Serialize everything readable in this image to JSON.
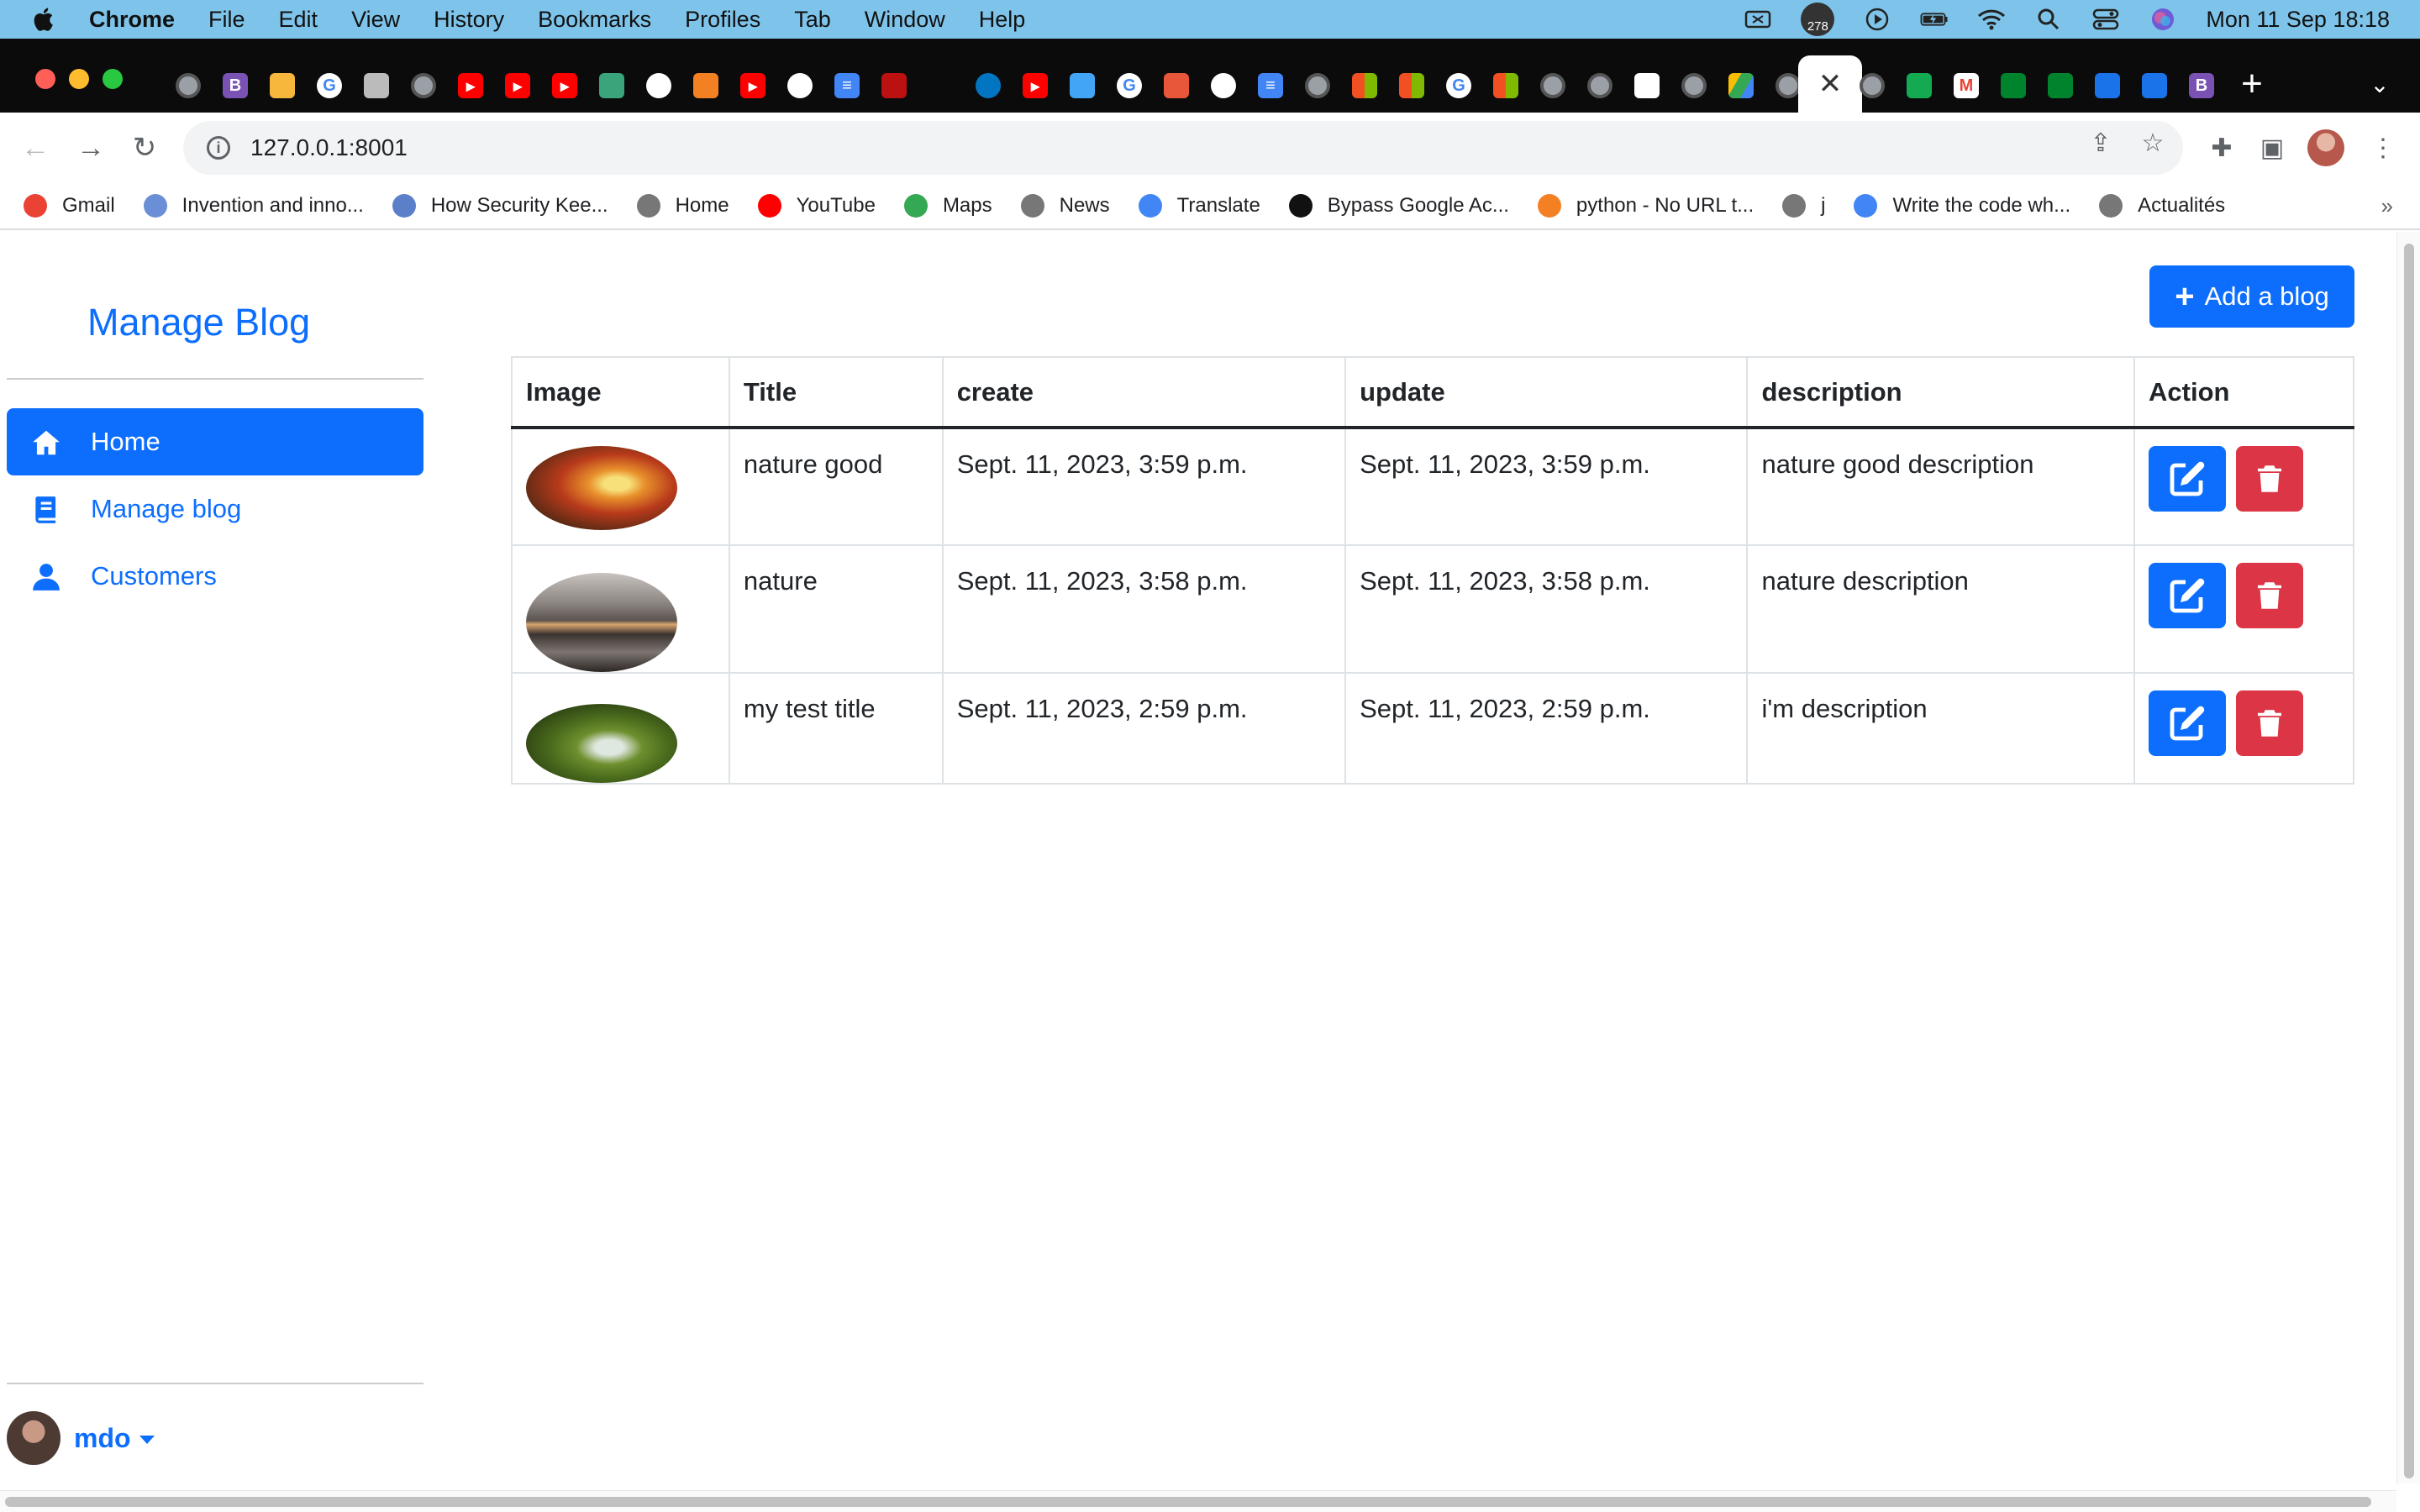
{
  "menubar": {
    "app": "Chrome",
    "items": [
      "File",
      "Edit",
      "View",
      "History",
      "Bookmarks",
      "Profiles",
      "Tab",
      "Window",
      "Help"
    ],
    "badge_count": "278",
    "datetime": "Mon 11 Sep  18:18"
  },
  "browser": {
    "url": "127.0.0.1:8001",
    "bookmarks": [
      {
        "label": "Gmail",
        "icon": "gmail-icon",
        "color": "#ea4335"
      },
      {
        "label": "Invention and inno...",
        "icon": "shield-icon",
        "color": "#6b8fd6"
      },
      {
        "label": "How Security Kee...",
        "icon": "cube-icon",
        "color": "#5b7fc9"
      },
      {
        "label": "Home",
        "icon": "globe-icon",
        "color": "#777777"
      },
      {
        "label": "YouTube",
        "icon": "youtube-icon",
        "color": "#ff0000"
      },
      {
        "label": "Maps",
        "icon": "maps-pin-icon",
        "color": "#34a853"
      },
      {
        "label": "News",
        "icon": "globe-icon",
        "color": "#777777"
      },
      {
        "label": "Translate",
        "icon": "translate-icon",
        "color": "#4285f4"
      },
      {
        "label": "Bypass Google Ac...",
        "icon": "bypass-icon",
        "color": "#111111"
      },
      {
        "label": "python - No URL t...",
        "icon": "stackoverflow-icon",
        "color": "#f48024"
      },
      {
        "label": "j",
        "icon": "globe-icon",
        "color": "#777777"
      },
      {
        "label": "Write the code wh...",
        "icon": "google-icon",
        "color": "#4285f4"
      },
      {
        "label": "Actualités",
        "icon": "globe-icon",
        "color": "#777777"
      }
    ],
    "bookmarks_more": "»"
  },
  "sidebar": {
    "brand": "Manage Blog",
    "items": [
      {
        "label": "Home",
        "icon": "home-icon",
        "active": true
      },
      {
        "label": "Manage blog",
        "icon": "book-icon",
        "active": false
      },
      {
        "label": "Customers",
        "icon": "person-icon",
        "active": false
      }
    ],
    "user": "mdo"
  },
  "main": {
    "add_button": "Add a blog",
    "columns": [
      "Image",
      "Title",
      "create",
      "update",
      "description",
      "Action"
    ],
    "rows": [
      {
        "title": "nature good",
        "create": "Sept. 11, 2023, 3:59 p.m.",
        "update": "Sept. 11, 2023, 3:59 p.m.",
        "description": "nature good description",
        "image": "autumn-forest"
      },
      {
        "title": "nature",
        "create": "Sept. 11, 2023, 3:58 p.m.",
        "update": "Sept. 11, 2023, 3:58 p.m.",
        "description": "nature description",
        "image": "mountain-lake"
      },
      {
        "title": "my test title",
        "create": "Sept. 11, 2023, 2:59 p.m.",
        "update": "Sept. 11, 2023, 2:59 p.m.",
        "description": "i'm description",
        "image": "mossy-stream"
      }
    ]
  },
  "colors": {
    "primary": "#0d6efd",
    "danger": "#dc3545"
  }
}
